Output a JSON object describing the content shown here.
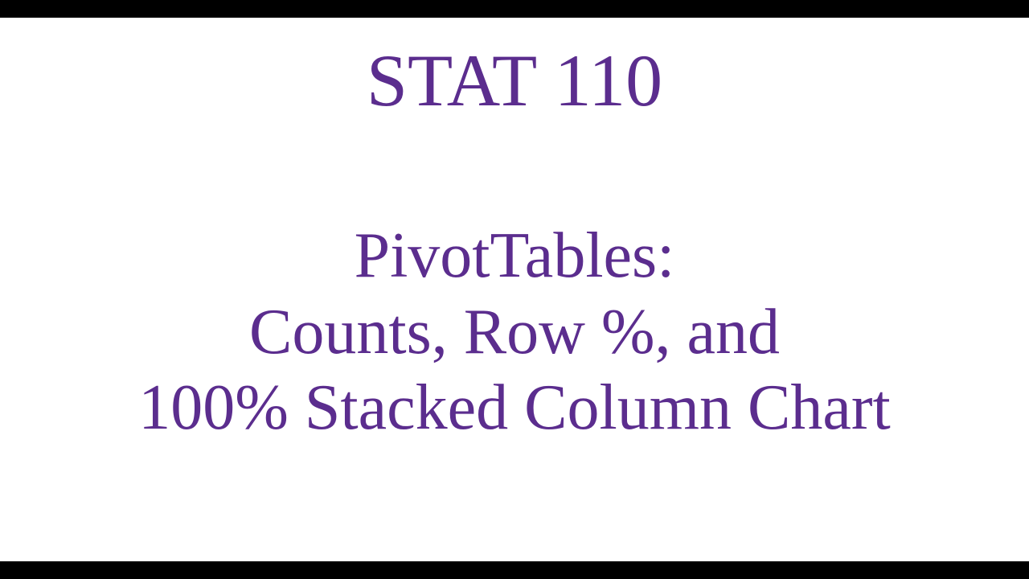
{
  "slide": {
    "title": "STAT 110",
    "subtitle_line1": "PivotTables:",
    "subtitle_line2": "Counts, Row %, and",
    "subtitle_line3": "100% Stacked Column Chart"
  }
}
